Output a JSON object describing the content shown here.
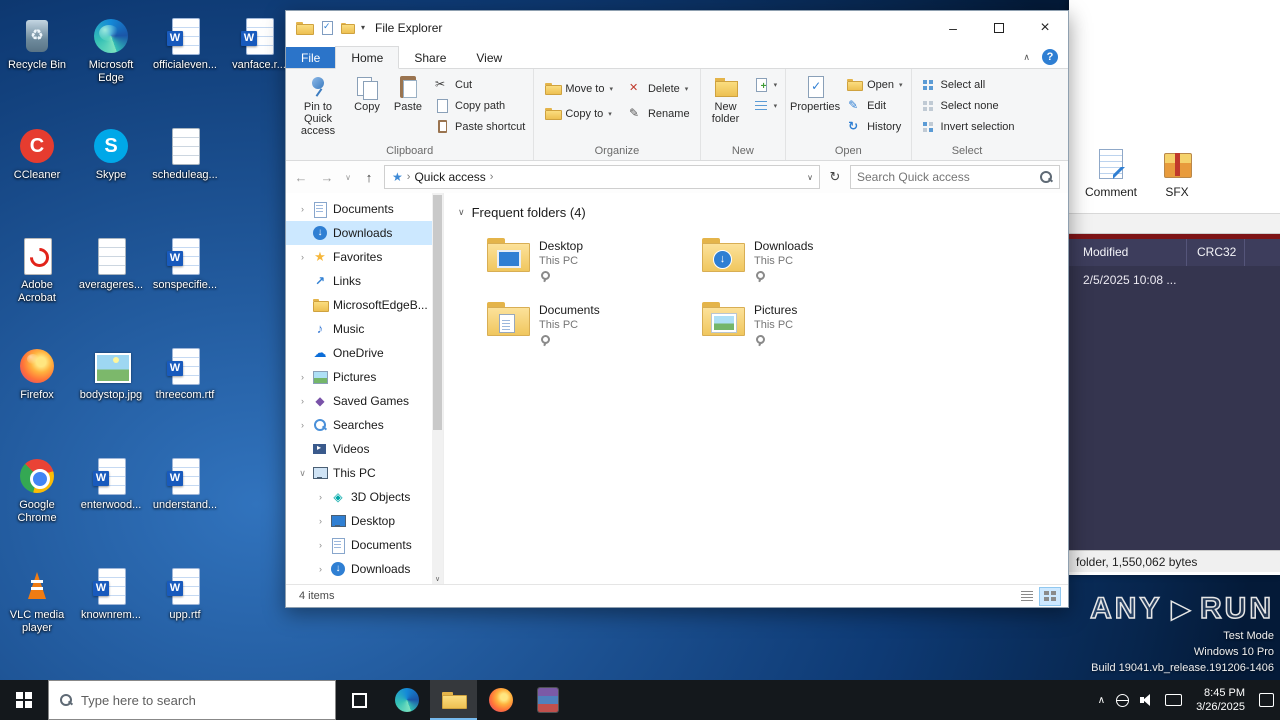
{
  "icons": {
    "back": "←",
    "forward": "→",
    "up": "↑",
    "refresh": "↻",
    "dropdown": "∨",
    "menu": "▾",
    "collapse": "∧",
    "help": "?",
    "crumb_sep": "›",
    "minimize": "–",
    "close": "×",
    "tray_chevron": "∧"
  },
  "desktop": {
    "icons": [
      {
        "label": "Recycle Bin",
        "type": "recycle-bin"
      },
      {
        "label": "CCleaner",
        "type": "ccleaner"
      },
      {
        "label": "Adobe Acrobat",
        "type": "acrobat"
      },
      {
        "label": "Firefox",
        "type": "firefox"
      },
      {
        "label": "Google Chrome",
        "type": "chrome"
      },
      {
        "label": "VLC media player",
        "type": "vlc"
      },
      {
        "label": "Microsoft Edge",
        "type": "edge"
      },
      {
        "label": "Skype",
        "type": "skype"
      },
      {
        "label": "averageres...",
        "type": "doc"
      },
      {
        "label": "bodystop.jpg",
        "type": "image"
      },
      {
        "label": "enterwood...",
        "type": "word"
      },
      {
        "label": "knownrem...",
        "type": "word"
      },
      {
        "label": "officialeven...",
        "type": "word"
      },
      {
        "label": "scheduleag...",
        "type": "doc"
      },
      {
        "label": "sonspecifie...",
        "type": "word"
      },
      {
        "label": "threecom.rtf",
        "type": "word"
      },
      {
        "label": "understand...",
        "type": "word"
      },
      {
        "label": "upp.rtf",
        "type": "word"
      },
      {
        "label": "vanface.r...",
        "type": "word"
      }
    ]
  },
  "explorer": {
    "title": "File Explorer",
    "tabs": [
      {
        "label": "File"
      },
      {
        "label": "Home"
      },
      {
        "label": "Share"
      },
      {
        "label": "View"
      }
    ],
    "ribbon": {
      "clipboard": {
        "pin_label": "Pin to Quick access",
        "copy": "Copy",
        "paste": "Paste",
        "cut": "Cut",
        "copy_path": "Copy path",
        "paste_shortcut": "Paste shortcut",
        "group_label": "Clipboard"
      },
      "organize": {
        "move_to": "Move to",
        "copy_to": "Copy to",
        "delete": "Delete",
        "rename": "Rename",
        "group_label": "Organize"
      },
      "new": {
        "new_folder": "New folder",
        "group_label": "New"
      },
      "open": {
        "properties": "Properties",
        "open": "Open",
        "edit": "Edit",
        "history": "History",
        "group_label": "Open"
      },
      "select": {
        "select_all": "Select all",
        "select_none": "Select none",
        "invert": "Invert selection",
        "group_label": "Select"
      }
    },
    "address": {
      "crumb": "Quick access",
      "search_placeholder": "Search Quick access"
    },
    "nav": [
      {
        "chev": "›",
        "icon": "documents",
        "label": "Documents"
      },
      {
        "chev": "",
        "icon": "downloads",
        "label": "Downloads",
        "selected": "true"
      },
      {
        "chev": "›",
        "icon": "favorites",
        "label": "Favorites"
      },
      {
        "chev": "",
        "icon": "links",
        "label": "Links"
      },
      {
        "chev": "",
        "icon": "folder",
        "label": "MicrosoftEdgeB..."
      },
      {
        "chev": "",
        "icon": "music",
        "label": "Music"
      },
      {
        "chev": "",
        "icon": "onedrive",
        "label": "OneDrive"
      },
      {
        "chev": "›",
        "icon": "pictures",
        "label": "Pictures"
      },
      {
        "chev": "›",
        "icon": "games",
        "label": "Saved Games"
      },
      {
        "chev": "›",
        "icon": "search",
        "label": "Searches"
      },
      {
        "chev": "",
        "icon": "videos",
        "label": "Videos"
      },
      {
        "chev": "∨",
        "icon": "pc",
        "label": "This PC"
      },
      {
        "chev": "›",
        "icon": "objects3d",
        "label": "3D Objects",
        "indent": "1"
      },
      {
        "chev": "›",
        "icon": "desktop",
        "label": "Desktop",
        "indent": "1"
      },
      {
        "chev": "›",
        "icon": "documents",
        "label": "Documents",
        "indent": "1"
      },
      {
        "chev": "›",
        "icon": "downloads",
        "label": "Downloads",
        "indent": "1"
      }
    ],
    "content": {
      "header": "Frequent folders (4)",
      "tiles": [
        {
          "name": "Desktop",
          "location": "This PC",
          "icon": "desktop-folder"
        },
        {
          "name": "Downloads",
          "location": "This PC",
          "icon": "downloads-folder"
        },
        {
          "name": "Documents",
          "location": "This PC",
          "icon": "documents-folder"
        },
        {
          "name": "Pictures",
          "location": "This PC",
          "icon": "pictures-folder"
        }
      ]
    },
    "status_text": "4 items"
  },
  "winrar": {
    "toolbar": [
      {
        "label": "Comment",
        "icon": "comment"
      },
      {
        "label": "SFX",
        "icon": "sfx"
      }
    ],
    "columns": [
      "Modified",
      "CRC32"
    ],
    "rows": [
      {
        "modified": "2/5/2025 10:08 ..."
      }
    ],
    "status": "folder, 1,550,062 bytes"
  },
  "watermark": {
    "any": "ANY",
    "run": "RUN",
    "line1": "Test Mode",
    "line2": "Windows 10 Pro",
    "line3": "Build 19041.vb_release.191206-1406"
  },
  "taskbar": {
    "search_placeholder": "Type here to search",
    "clock_time": "8:45 PM",
    "clock_date": "3/26/2025"
  }
}
